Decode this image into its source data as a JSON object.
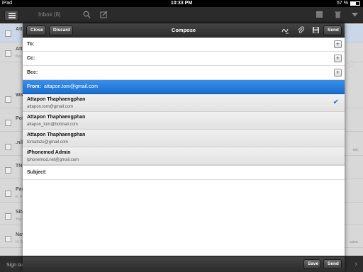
{
  "status_bar": {
    "device": "iPad",
    "time": "10:33 PM",
    "battery": "57 %"
  },
  "app_toolbar": {
    "inbox_title": "Inbox (8)"
  },
  "inbox_rows": [
    {
      "sender": "Atta",
      "snippet": "",
      "snippet_right": ""
    },
    {
      "sender": "Atta",
      "snippet": "Bes",
      "snippet_right": ""
    },
    {
      "sender": "Wa",
      "snippet": "",
      "snippet_right": ""
    },
    {
      "sender": "Pol",
      "snippet": "",
      "snippet_right": ""
    },
    {
      "sender": ".nil",
      "snippet": "",
      "snippet_right": "eet."
    },
    {
      "sender": "TNS",
      "snippet": "",
      "snippet_right": ""
    },
    {
      "sender": "Paw",
      "snippet": "K, A",
      "snippet_right": ""
    },
    {
      "sender": "Site",
      "snippet": "You",
      "snippet_right": ""
    },
    {
      "sender": "Nav",
      "snippet": "H, W",
      "snippet_right": "ssion."
    }
  ],
  "bottom_bar": {
    "sign_out": "Sign out"
  },
  "compose": {
    "title": "Compose",
    "close_label": "Close",
    "discard_label": "Discard",
    "send_label": "Send",
    "save_label": "Save",
    "footer_send_label": "Send",
    "fields": {
      "to": "To:",
      "cc": "Cc:",
      "bcc": "Bcc:",
      "subject": "Subject:"
    },
    "from": {
      "label": "From:",
      "value": "attapon.tom@gmail.com"
    },
    "accounts": [
      {
        "name": "Attapon Thaphaengphan",
        "email": "attapon.tom@gmail.com",
        "selected": true
      },
      {
        "name": "Attapon Thaphaengphan",
        "email": "attapon_tom@hotmail.com",
        "selected": false
      },
      {
        "name": "Attapon Thaphaengphan",
        "email": "tomatoze@gmail.com",
        "selected": false
      },
      {
        "name": "iPhonemod Admin",
        "email": "iphonemod.net@gmail.com",
        "selected": false
      }
    ]
  },
  "colors": {
    "accent": "#1a6fd1",
    "toolbar": "#2c2c2c"
  }
}
